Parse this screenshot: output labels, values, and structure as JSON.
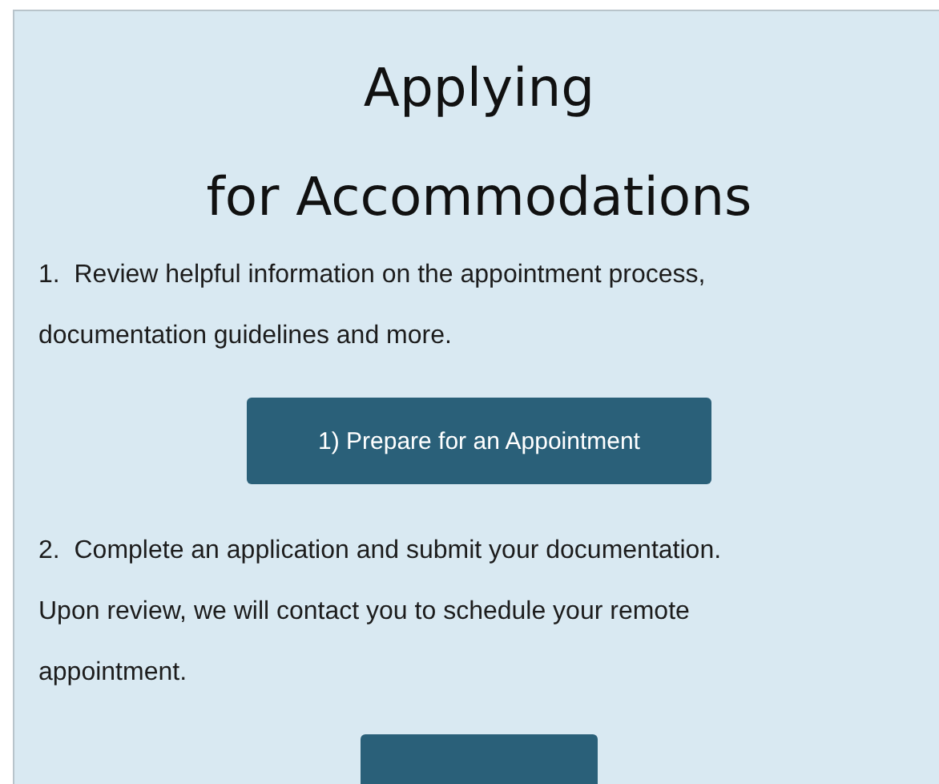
{
  "heading": [
    "Applying",
    "for Accommodations"
  ],
  "steps": [
    {
      "text": "1.  Review helpful information on the appointment process, documentation guidelines and more.",
      "button": {
        "label": "1) Prepare for an Appointment"
      }
    },
    {
      "text": "2.  Complete an application and submit your documentation.  Upon review, we will contact you to schedule your remote appointment.",
      "button": {
        "kind": "cut_off"
      }
    }
  ]
}
